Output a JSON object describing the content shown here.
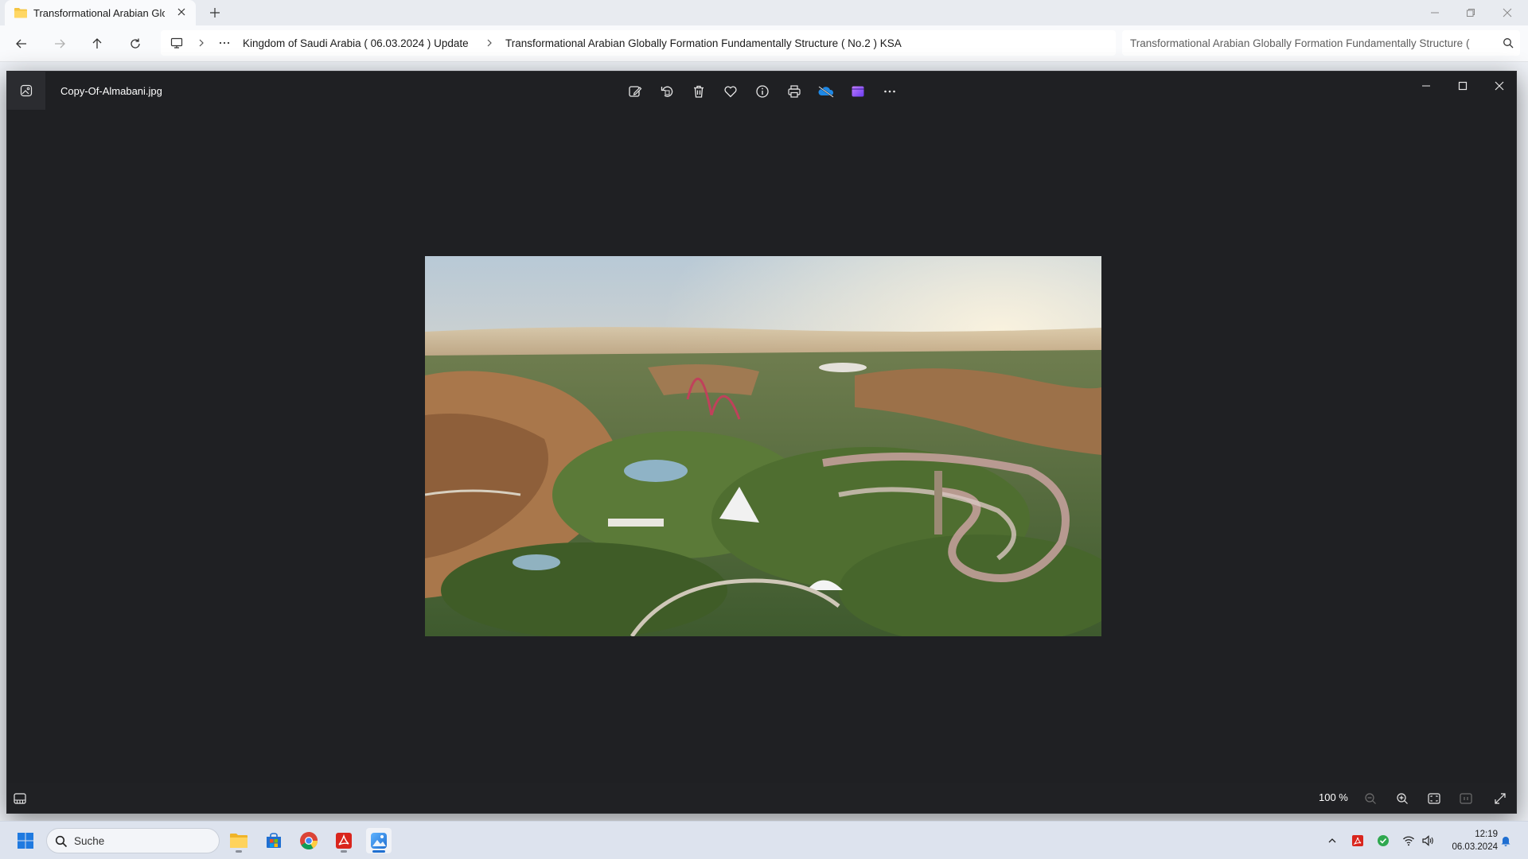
{
  "explorer": {
    "tab_title": "Transformational Arabian Glob",
    "breadcrumb": [
      "Kingdom of Saudi Arabia ( 06.03.2024 ) Update",
      "Transformational Arabian Globally Formation Fundamentally Structure  ( No.2 ) KSA"
    ],
    "search_text": "Transformational Arabian Globally Formation Fundamentally Structure  ("
  },
  "photos": {
    "filename": "Copy-Of-Almabani.jpg",
    "toolbar": [
      "edit-icon",
      "rotate-icon",
      "delete-icon",
      "favorite-icon",
      "info-icon",
      "print-icon",
      "onedrive-icon",
      "clipchamp-icon",
      "more-icon"
    ],
    "zoom_level": "100 %",
    "image_subject": "aerial-desert-resort-render"
  },
  "taskbar": {
    "search_placeholder": "Suche",
    "apps": [
      "file-explorer-icon",
      "microsoft-store-icon",
      "chrome-icon",
      "acrobat-icon",
      "photos-icon"
    ],
    "clock_time": "12:19",
    "clock_date": "06.03.2024"
  },
  "colors": {
    "viewer_bg": "#1f2023",
    "taskbar_bg": "#dde3ee",
    "accent": "#1f6fd1"
  }
}
